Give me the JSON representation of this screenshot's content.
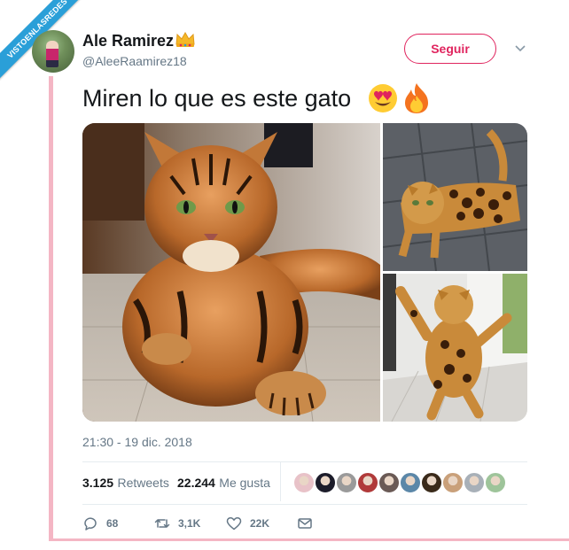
{
  "watermark": {
    "text": "VISTOENLASREDES"
  },
  "author": {
    "name": "Ale Ramirez",
    "handle": "@AleeRaamirez18",
    "name_emoji": "crown-icon"
  },
  "follow_button": {
    "label": "Seguir",
    "color": "#e0245e"
  },
  "tweet": {
    "text": "Miren lo que es este gato",
    "emojis": [
      "heart-eyes-emoji",
      "fire-emoji"
    ],
    "timestamp": "21:30 - 19 dic. 2018"
  },
  "stats": {
    "retweets_count": "3.125",
    "retweets_label": "Retweets",
    "likes_count": "22.244",
    "likes_label": "Me gusta"
  },
  "likers": [
    {
      "color": "#e8c2c8"
    },
    {
      "color": "#1c1c2a"
    },
    {
      "color": "#9a9a9a"
    },
    {
      "color": "#b03a3a"
    },
    {
      "color": "#6a5a55"
    },
    {
      "color": "#5b87a8"
    },
    {
      "color": "#3a2a1a"
    },
    {
      "color": "#c9a07a"
    },
    {
      "color": "#a8b0b8"
    },
    {
      "color": "#9ec49a"
    }
  ],
  "actions": {
    "replies": "68",
    "retweets": "3,1K",
    "likes": "22K"
  },
  "colors": {
    "accent": "#e0245e",
    "ribbon": "#2a9fd8",
    "frame_rule": "#f4b6c4",
    "secondary_text": "#657786"
  }
}
